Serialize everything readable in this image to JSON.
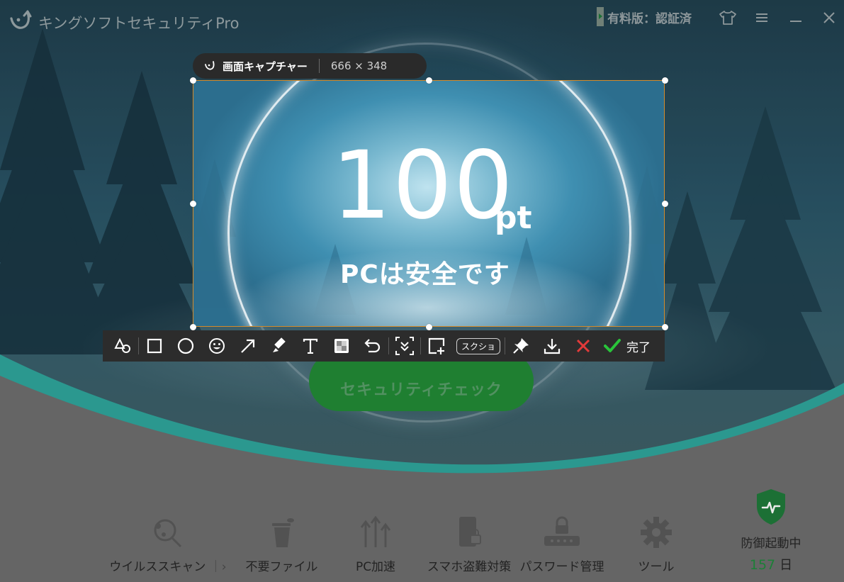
{
  "app": {
    "title": "キングソフトセキュリティPro",
    "license": "有料版：認証済",
    "colors": {
      "accent_green": "#228a36",
      "teal": "#2fa59c",
      "days_green": "#1f8a3c"
    }
  },
  "window_controls": [
    "skin-icon",
    "menu-icon",
    "minimize-icon",
    "close-icon"
  ],
  "capture": {
    "title": "画面キャプチャー",
    "size": "666 × 348"
  },
  "screen": {
    "score": "100",
    "score_unit": "pt",
    "status": "PCは安全です",
    "check_button": "セキュリティチェック"
  },
  "toolbar": {
    "tools": [
      "shape-tool-icon",
      "rectangle-tool-icon",
      "ellipse-tool-icon",
      "emoji-tool-icon",
      "arrow-tool-icon",
      "marker-tool-icon",
      "text-tool-icon",
      "mosaic-tool-icon",
      "undo-icon",
      "scroll-capture-icon",
      "add-capture-icon"
    ],
    "screenshot_label": "スクショ",
    "done_label": "完了"
  },
  "nav": {
    "scan": "ウイルススキャン",
    "scan_sep": "｜",
    "junk": "不要ファイル",
    "speedup": "PC加速",
    "phone": "スマホ盗難対策",
    "password": "パスワード管理",
    "tools": "ツール",
    "defense_label": "防御起動中",
    "defense_days": "157",
    "defense_unit": "日"
  }
}
